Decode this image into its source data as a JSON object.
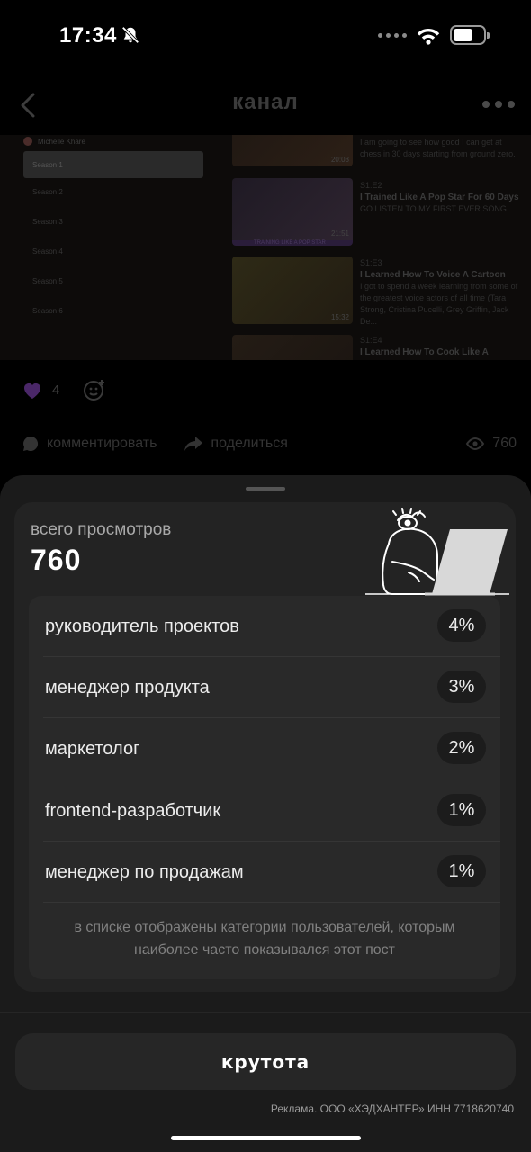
{
  "status_bar": {
    "time": "17:34"
  },
  "nav": {
    "title": "канал"
  },
  "post_preview": {
    "author": "Michelle Khare",
    "seasons": [
      "Season 1",
      "Season 2",
      "Season 3",
      "Season 4",
      "Season 5",
      "Season 6"
    ],
    "videos": [
      {
        "duration": "20:03",
        "meta": "",
        "title": "",
        "desc": "I am going to see how good I can get at chess in 30 days starting from ground zero."
      },
      {
        "duration": "21:51",
        "meta": "S1:E2",
        "title": "I Trained Like A Pop Star For 60 Days",
        "desc": "GO LISTEN TO MY FIRST EVER SONG",
        "thumb_caption": "TRAINING LIKE A POP STAR"
      },
      {
        "duration": "15:32",
        "meta": "S1:E3",
        "title": "I Learned How To Voice A Cartoon",
        "desc": "I got to spend a week learning from some of the greatest voice actors of all time (Tara Strong, Cristina Pucelli, Grey Griffin, Jack De..."
      },
      {
        "duration": "",
        "meta": "S1:E4",
        "title": "I Learned How To Cook Like A",
        "desc": ""
      }
    ]
  },
  "reactions": {
    "count": "4"
  },
  "actions": {
    "comment": "комментировать",
    "share": "поделиться",
    "views": "760"
  },
  "stats": {
    "label": "всего просмотров",
    "total": "760",
    "audience": [
      {
        "label": "руководитель проектов",
        "pct": "4%"
      },
      {
        "label": "менеджер продукта",
        "pct": "3%"
      },
      {
        "label": "маркетолог",
        "pct": "2%"
      },
      {
        "label": "frontend-разработчик",
        "pct": "1%"
      },
      {
        "label": "менеджер по продажам",
        "pct": "1%"
      }
    ],
    "note": "в списке отображены категории пользователей, которым наиболее часто показывался этот пост"
  },
  "cta": {
    "label": "крутота"
  },
  "footer": {
    "ad_disclaimer": "Реклама. ООО «ХЭДХАНТЕР» ИНН 7718620740"
  }
}
